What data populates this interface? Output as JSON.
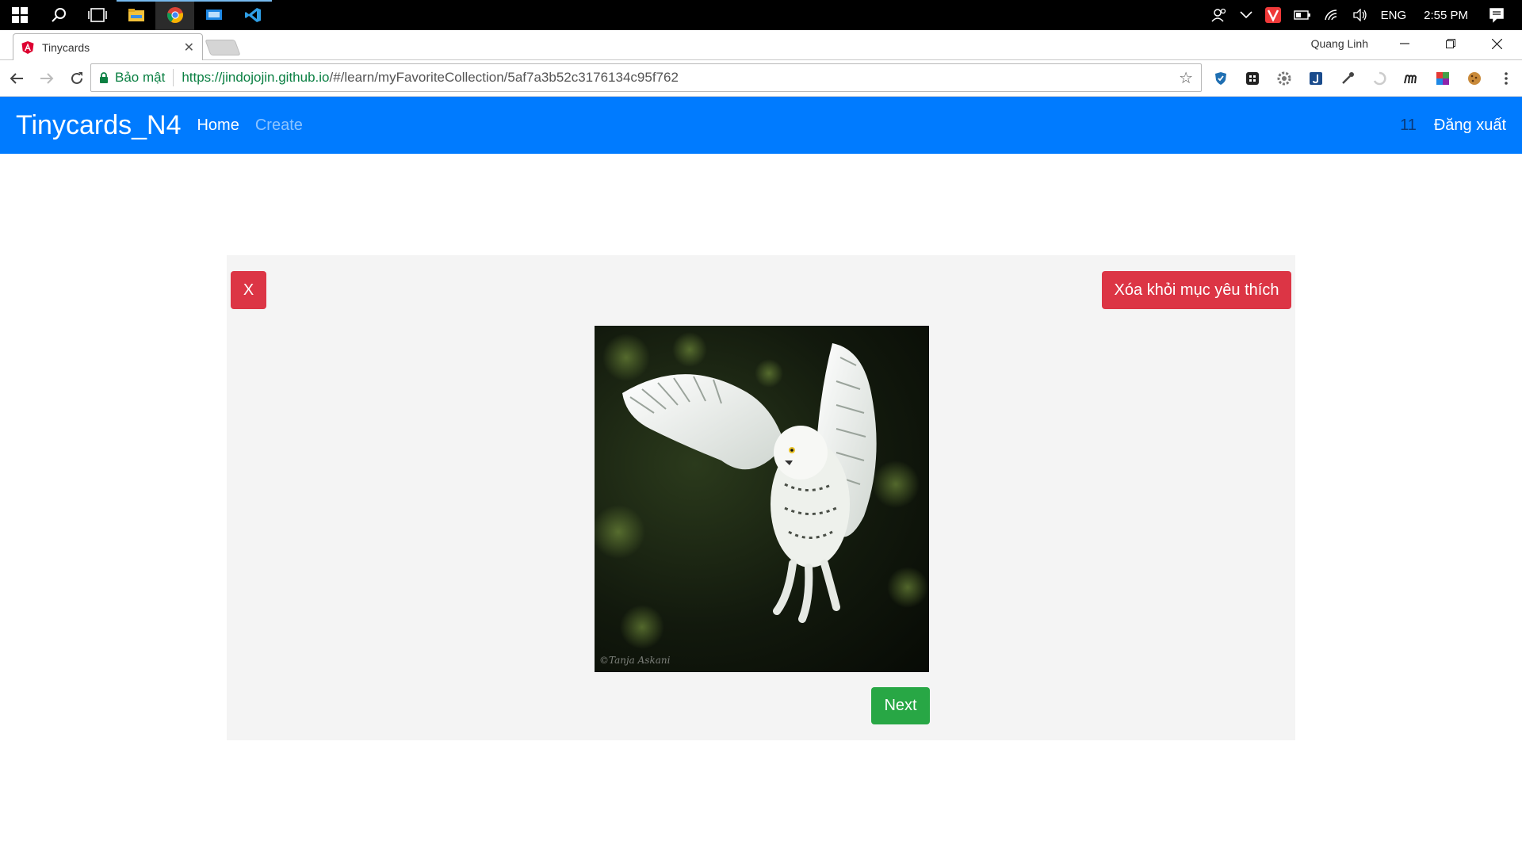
{
  "browser": {
    "tab_title": "Tinycards",
    "profile_name": "Quang Linh",
    "secure_label": "Bảo mật",
    "url_host": "https://jindojojin.github.io",
    "url_path": "/#/learn/myFavoriteCollection/5af7a3b52c3176134c95f762"
  },
  "system": {
    "language": "ENG",
    "time": "2:55 PM"
  },
  "navbar": {
    "brand": "Tinycards_N4",
    "links": [
      "Home",
      "Create"
    ],
    "count": "11",
    "logout": "Đăng xuất",
    "color": "#007bff"
  },
  "card": {
    "close_label": "X",
    "remove_favorite_label": "Xóa khỏi mục yêu thích",
    "image_subject": "snowy owl in flight",
    "watermark": "©Tanja Askani",
    "next_label": "Next"
  },
  "colors": {
    "danger": "#dc3545",
    "success": "#28a745",
    "card_bg": "#f4f4f4"
  }
}
